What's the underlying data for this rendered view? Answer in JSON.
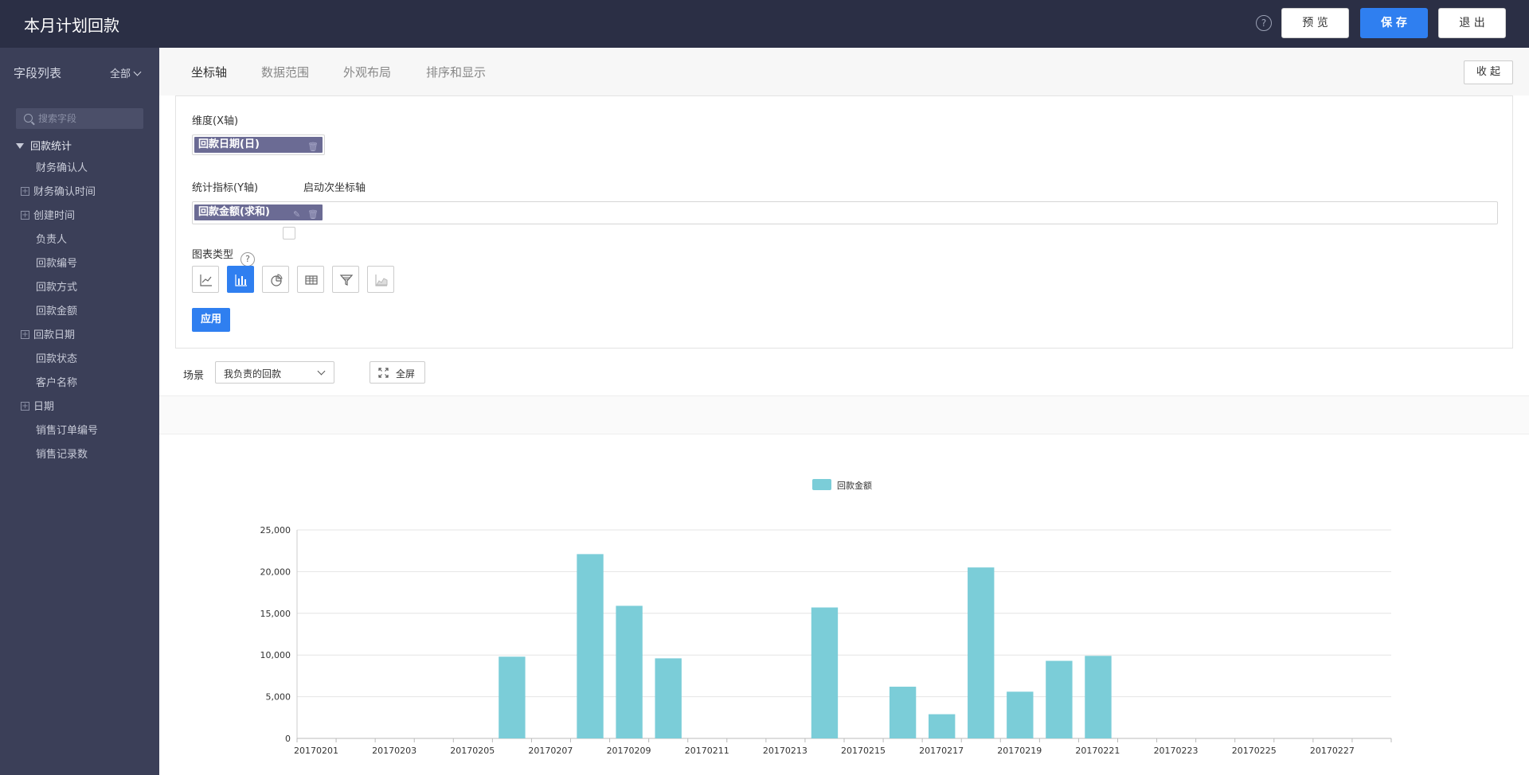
{
  "header": {
    "title": "本月计划回款",
    "help_label": "?",
    "preview_label": "预 览",
    "save_label": "保 存",
    "exit_label": "退 出"
  },
  "sidebar": {
    "title": "字段列表",
    "filter_label": "全部",
    "search_placeholder": "搜索字段",
    "root_label": "回款统计",
    "items": [
      {
        "label": "财务确认人",
        "expandable": false
      },
      {
        "label": "财务确认时间",
        "expandable": true
      },
      {
        "label": "创建时间",
        "expandable": true
      },
      {
        "label": "负责人",
        "expandable": false
      },
      {
        "label": "回款编号",
        "expandable": false
      },
      {
        "label": "回款方式",
        "expandable": false
      },
      {
        "label": "回款金额",
        "expandable": false
      },
      {
        "label": "回款日期",
        "expandable": true
      },
      {
        "label": "回款状态",
        "expandable": false
      },
      {
        "label": "客户名称",
        "expandable": false
      },
      {
        "label": "日期",
        "expandable": true
      },
      {
        "label": "销售订单编号",
        "expandable": false
      },
      {
        "label": "销售记录数",
        "expandable": false
      }
    ]
  },
  "tabs": {
    "axis": "坐标轴",
    "data_range": "数据范围",
    "layout": "外观布局",
    "sort_display": "排序和显示",
    "collapse_label": "收 起"
  },
  "config": {
    "dimension_label": "维度(X轴)",
    "dimension_pill": "回款日期(日)",
    "metric_label": "统计指标(Y轴)",
    "secondary_axis_label": "启动次坐标轴",
    "metric_pill": "回款金额(求和)",
    "chart_type_label": "图表类型",
    "chart_type_help": "?",
    "chart_types": [
      "line-chart-icon",
      "bar-chart-icon",
      "pie-chart-icon",
      "table-icon",
      "funnel-icon",
      "area-chart-icon"
    ],
    "active_chart_type": "bar-chart-icon",
    "apply_label": "应用"
  },
  "scene": {
    "label": "场景",
    "value": "我负责的回款",
    "fullscreen_label": "全屏"
  },
  "colors": {
    "header_bg": "#2b2f45",
    "sidebar_bg": "#3b3f58",
    "accent": "#2f7ff0",
    "bar": "#7bcdd8",
    "pill": "#6b6b94"
  },
  "chart_data": {
    "type": "bar",
    "series": [
      {
        "name": "回款金额",
        "x": [
          "20170201",
          "20170202",
          "20170203",
          "20170204",
          "20170205",
          "20170206",
          "20170207",
          "20170208",
          "20170209",
          "20170210",
          "20170211",
          "20170212",
          "20170213",
          "20170214",
          "20170215",
          "20170216",
          "20170217",
          "20170218",
          "20170219",
          "20170220",
          "20170221",
          "20170222",
          "20170223",
          "20170224",
          "20170225",
          "20170226",
          "20170227",
          "20170228"
        ],
        "values": [
          0,
          0,
          0,
          0,
          0,
          9800,
          0,
          22100,
          15900,
          9600,
          0,
          0,
          0,
          15700,
          0,
          6200,
          2900,
          20500,
          5600,
          9300,
          9900,
          0,
          0,
          0,
          0,
          0,
          0,
          0
        ]
      }
    ],
    "x_tick_labels": [
      "20170201",
      "20170203",
      "20170205",
      "20170207",
      "20170209",
      "20170211",
      "20170213",
      "20170215",
      "20170217",
      "20170219",
      "20170221",
      "20170223",
      "20170225",
      "20170227"
    ],
    "y_tick_labels": [
      "0",
      "5,000",
      "10,000",
      "15,000",
      "20,000",
      "25,000"
    ],
    "ylim": [
      0,
      25000
    ],
    "legend_position": "top-center",
    "grid": true
  }
}
